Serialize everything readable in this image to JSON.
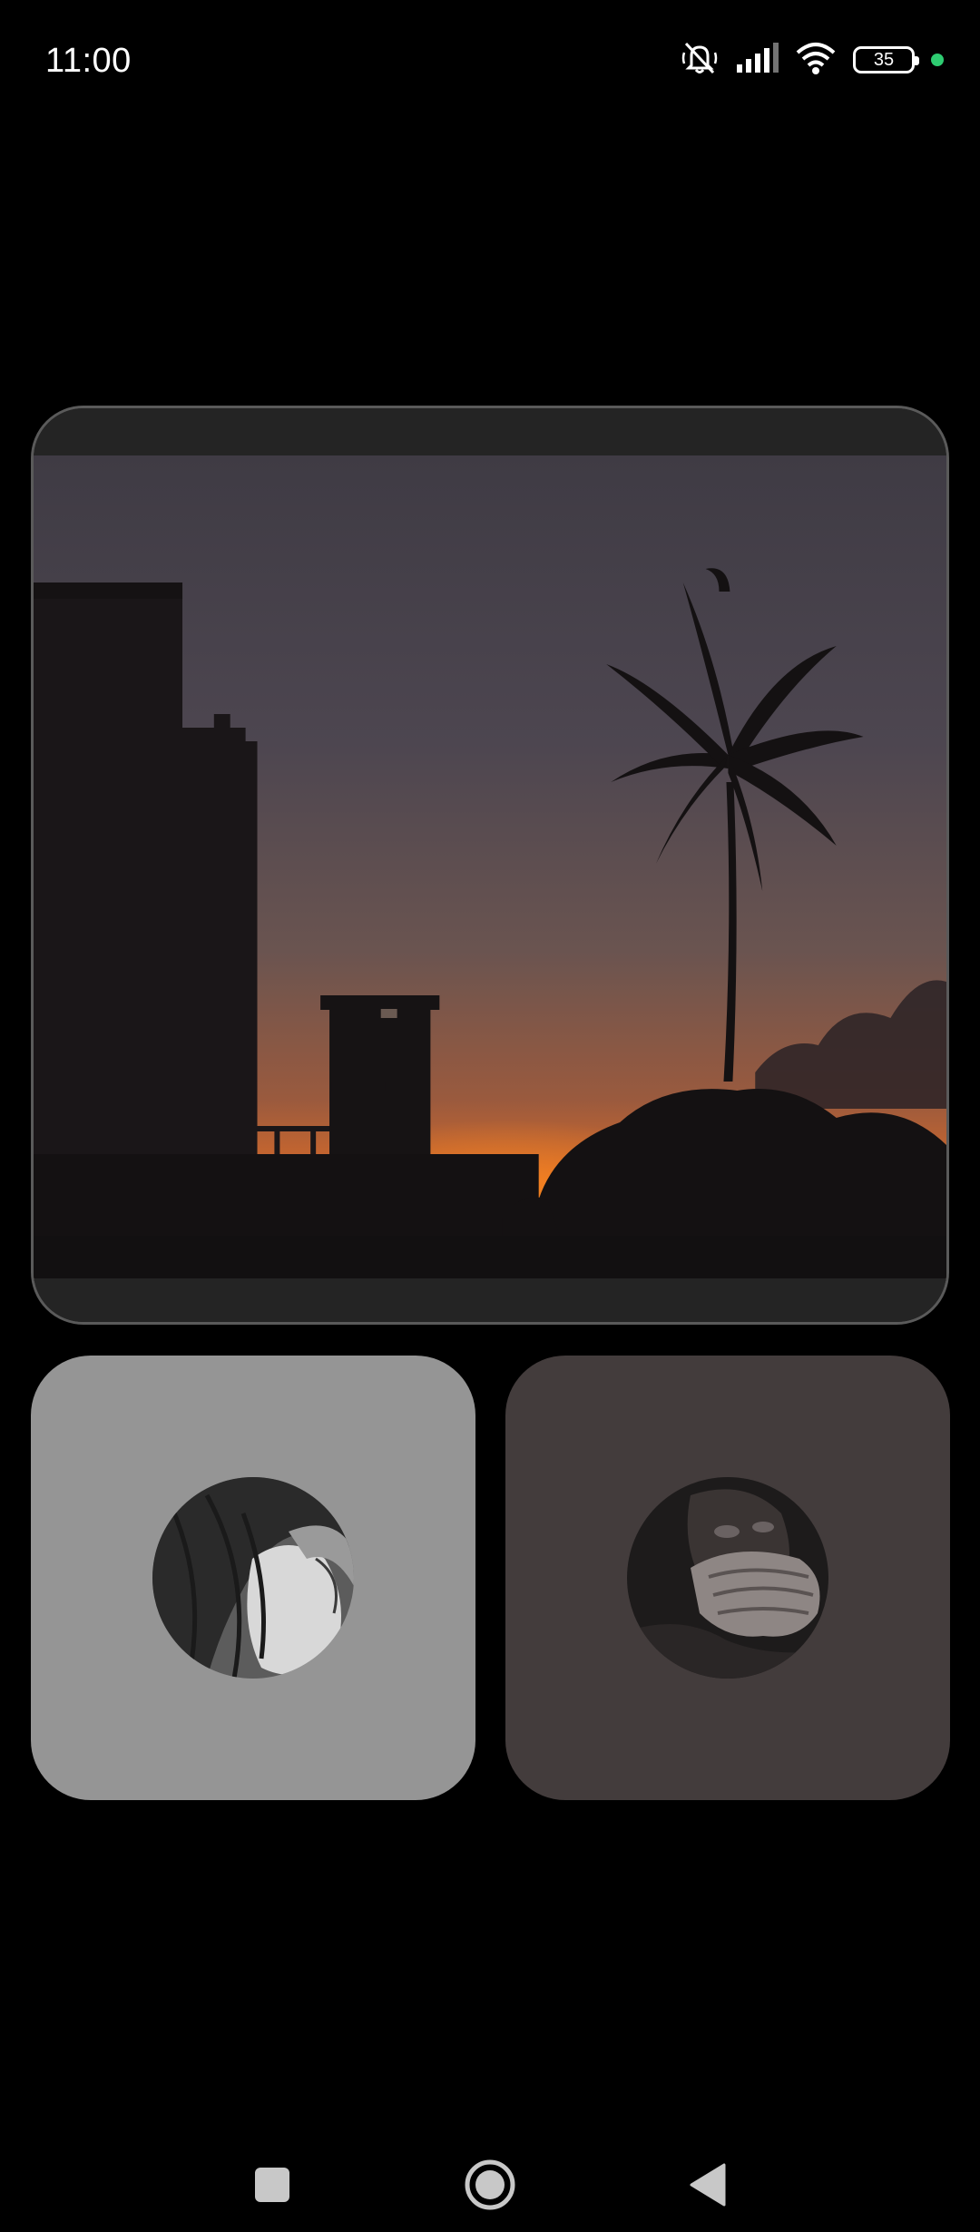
{
  "status_bar": {
    "time": "11:00",
    "battery_level": "35",
    "icons": [
      "mute-icon",
      "signal-icon",
      "wifi-icon",
      "battery-icon",
      "active-dot-icon"
    ],
    "active_dot_color": "#2ecc71"
  },
  "main_video": {
    "icon": "video-stream"
  },
  "participants": [
    {
      "tile_color": "#959595",
      "avatar": "participant-avatar"
    },
    {
      "tile_color": "#433c3c",
      "avatar": "participant-avatar"
    }
  ],
  "nav_bar": {
    "icons": [
      "recents-icon",
      "home-icon",
      "back-icon"
    ]
  }
}
